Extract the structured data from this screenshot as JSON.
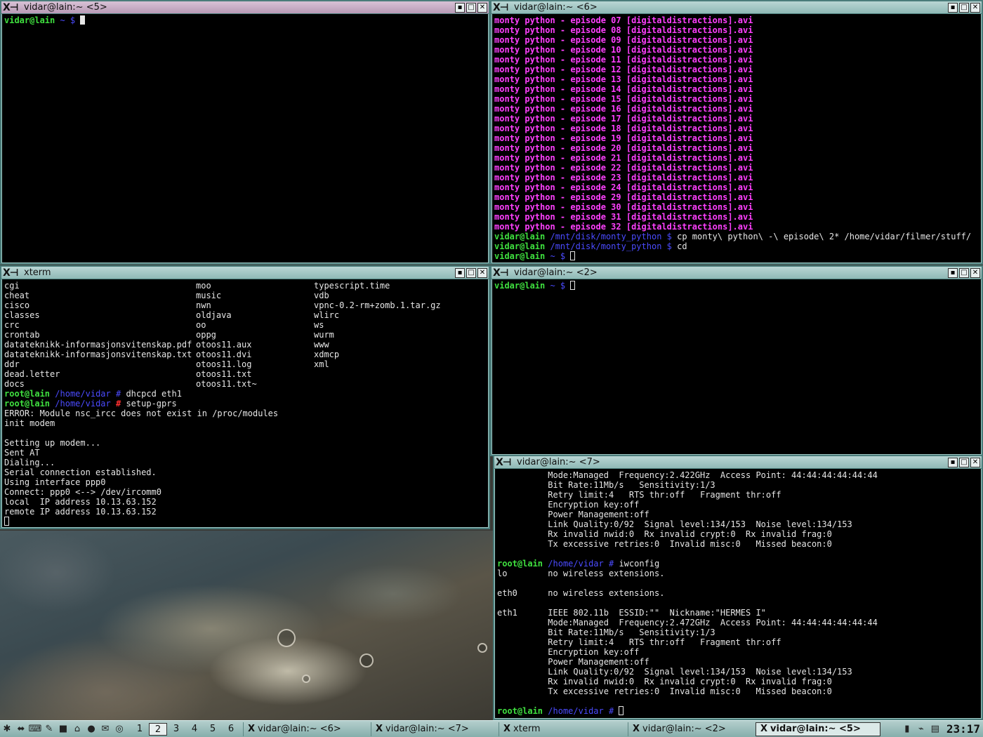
{
  "windows": {
    "w5": {
      "title": "vidar@lain:~ <5>",
      "prompt_user": "vidar@lain",
      "prompt_path": "~ $"
    },
    "w6": {
      "title": "vidar@lain:~ <6>",
      "files": [
        "monty python - episode 07 [digitaldistractions].avi",
        "monty python - episode 08 [digitaldistractions].avi",
        "monty python - episode 09 [digitaldistractions].avi",
        "monty python - episode 10 [digitaldistractions].avi",
        "monty python - episode 11 [digitaldistractions].avi",
        "monty python - episode 12 [digitaldistractions].avi",
        "monty python - episode 13 [digitaldistractions].avi",
        "monty python - episode 14 [digitaldistractions].avi",
        "monty python - episode 15 [digitaldistractions].avi",
        "monty python - episode 16 [digitaldistractions].avi",
        "monty python - episode 17 [digitaldistractions].avi",
        "monty python - episode 18 [digitaldistractions].avi",
        "monty python - episode 19 [digitaldistractions].avi",
        "monty python - episode 20 [digitaldistractions].avi",
        "monty python - episode 21 [digitaldistractions].avi",
        "monty python - episode 22 [digitaldistractions].avi",
        "monty python - episode 23 [digitaldistractions].avi",
        "monty python - episode 24 [digitaldistractions].avi",
        "monty python - episode 29 [digitaldistractions].avi",
        "monty python - episode 30 [digitaldistractions].avi",
        "monty python - episode 31 [digitaldistractions].avi",
        "monty python - episode 32 [digitaldistractions].avi"
      ],
      "cmd1_user": "vidar@lain",
      "cmd1_path": "/mnt/disk/monty_python $",
      "cmd1_text": " cp monty\\ python\\ -\\ episode\\ 2* /home/vidar/filmer/stuff/",
      "cmd2_user": "vidar@lain",
      "cmd2_path": "/mnt/disk/monty_python $",
      "cmd2_text": " cd",
      "cmd3_user": "vidar@lain",
      "cmd3_path": "~ $"
    },
    "xterm": {
      "title": "xterm",
      "ls_col1": [
        "cgi",
        "cheat",
        "cisco",
        "classes",
        "crc",
        "crontab",
        "datateknikk-informasjonsvitenskap.pdf",
        "datateknikk-informasjonsvitenskap.txt",
        "ddr",
        "dead.letter",
        "docs"
      ],
      "ls_col2": [
        "moo",
        "music",
        "nwn",
        "oldjava",
        "oo",
        "oppg",
        "otoos11.aux",
        "otoos11.dvi",
        "otoos11.log",
        "otoos11.txt",
        "otoos11.txt~"
      ],
      "ls_col3": [
        "typescript.time",
        "vdb",
        "vpnc-0.2-rm+zomb.1.tar.gz",
        "wlirc",
        "ws",
        "wurm",
        "www",
        "xdmcp",
        "xml"
      ],
      "p1_user": "root@lain",
      "p1_path": "/home/vidar",
      "p1_sym": "#",
      "p1_cmd": " dhcpcd eth1",
      "p2_user": "root@lain",
      "p2_path": "/home/vidar",
      "p2_sym": "#",
      "p2_cmd": " setup-gprs",
      "output": [
        "ERROR: Module nsc_ircc does not exist in /proc/modules",
        "init modem",
        "",
        "Setting up modem...",
        "Sent AT",
        "Dialing...",
        "Serial connection established.",
        "Using interface ppp0",
        "Connect: ppp0 <--> /dev/ircomm0",
        "local  IP address 10.13.63.152",
        "remote IP address 10.13.63.152"
      ]
    },
    "w2": {
      "title": "vidar@lain:~ <2>",
      "prompt_user": "vidar@lain",
      "prompt_path": "~ $"
    },
    "w7": {
      "title": "vidar@lain:~ <7>",
      "top_lines": [
        "          Mode:Managed  Frequency:2.422GHz  Access Point: 44:44:44:44:44:44",
        "          Bit Rate:11Mb/s   Sensitivity:1/3",
        "          Retry limit:4   RTS thr:off   Fragment thr:off",
        "          Encryption key:off",
        "          Power Management:off",
        "          Link Quality:0/92  Signal level:134/153  Noise level:134/153",
        "          Rx invalid nwid:0  Rx invalid crypt:0  Rx invalid frag:0",
        "          Tx excessive retries:0  Invalid misc:0   Missed beacon:0",
        ""
      ],
      "p1_user": "root@lain",
      "p1_path": "/home/vidar",
      "p1_sym": "#",
      "p1_cmd": " iwconfig",
      "bottom_lines": [
        "lo        no wireless extensions.",
        "",
        "eth0      no wireless extensions.",
        "",
        "eth1      IEEE 802.11b  ESSID:\"\"  Nickname:\"HERMES I\"",
        "          Mode:Managed  Frequency:2.472GHz  Access Point: 44:44:44:44:44:44",
        "          Bit Rate:11Mb/s   Sensitivity:1/3",
        "          Retry limit:4   RTS thr:off   Fragment thr:off",
        "          Encryption key:off",
        "          Power Management:off",
        "          Link Quality:0/92  Signal level:134/153  Noise level:134/153",
        "          Rx invalid nwid:0  Rx invalid crypt:0  Rx invalid frag:0",
        "          Tx excessive retries:0  Invalid misc:0   Missed beacon:0",
        ""
      ],
      "p2_user": "root@lain",
      "p2_path": "/home/vidar",
      "p2_sym": "#"
    }
  },
  "taskbar": {
    "pager": [
      "1",
      "2",
      "3",
      "4",
      "5",
      "6"
    ],
    "active_desktop": "2",
    "tasks": [
      {
        "label": "vidar@lain:~ <6>",
        "active": false
      },
      {
        "label": "vidar@lain:~ <7>",
        "active": false
      },
      {
        "label": "xterm",
        "active": false
      },
      {
        "label": "vidar@lain:~ <2>",
        "active": false
      },
      {
        "label": "vidar@lain:~ <5>",
        "active": true
      }
    ],
    "clock": "23:17"
  },
  "colors": {
    "prompt_user": "#3fe03f",
    "prompt_path": "#4b4bff",
    "root_symbol": "#ff3030",
    "filename": "#ff40ff",
    "active_titlebar": "#c8aec6",
    "inactive_titlebar": "#a3c8c5"
  }
}
